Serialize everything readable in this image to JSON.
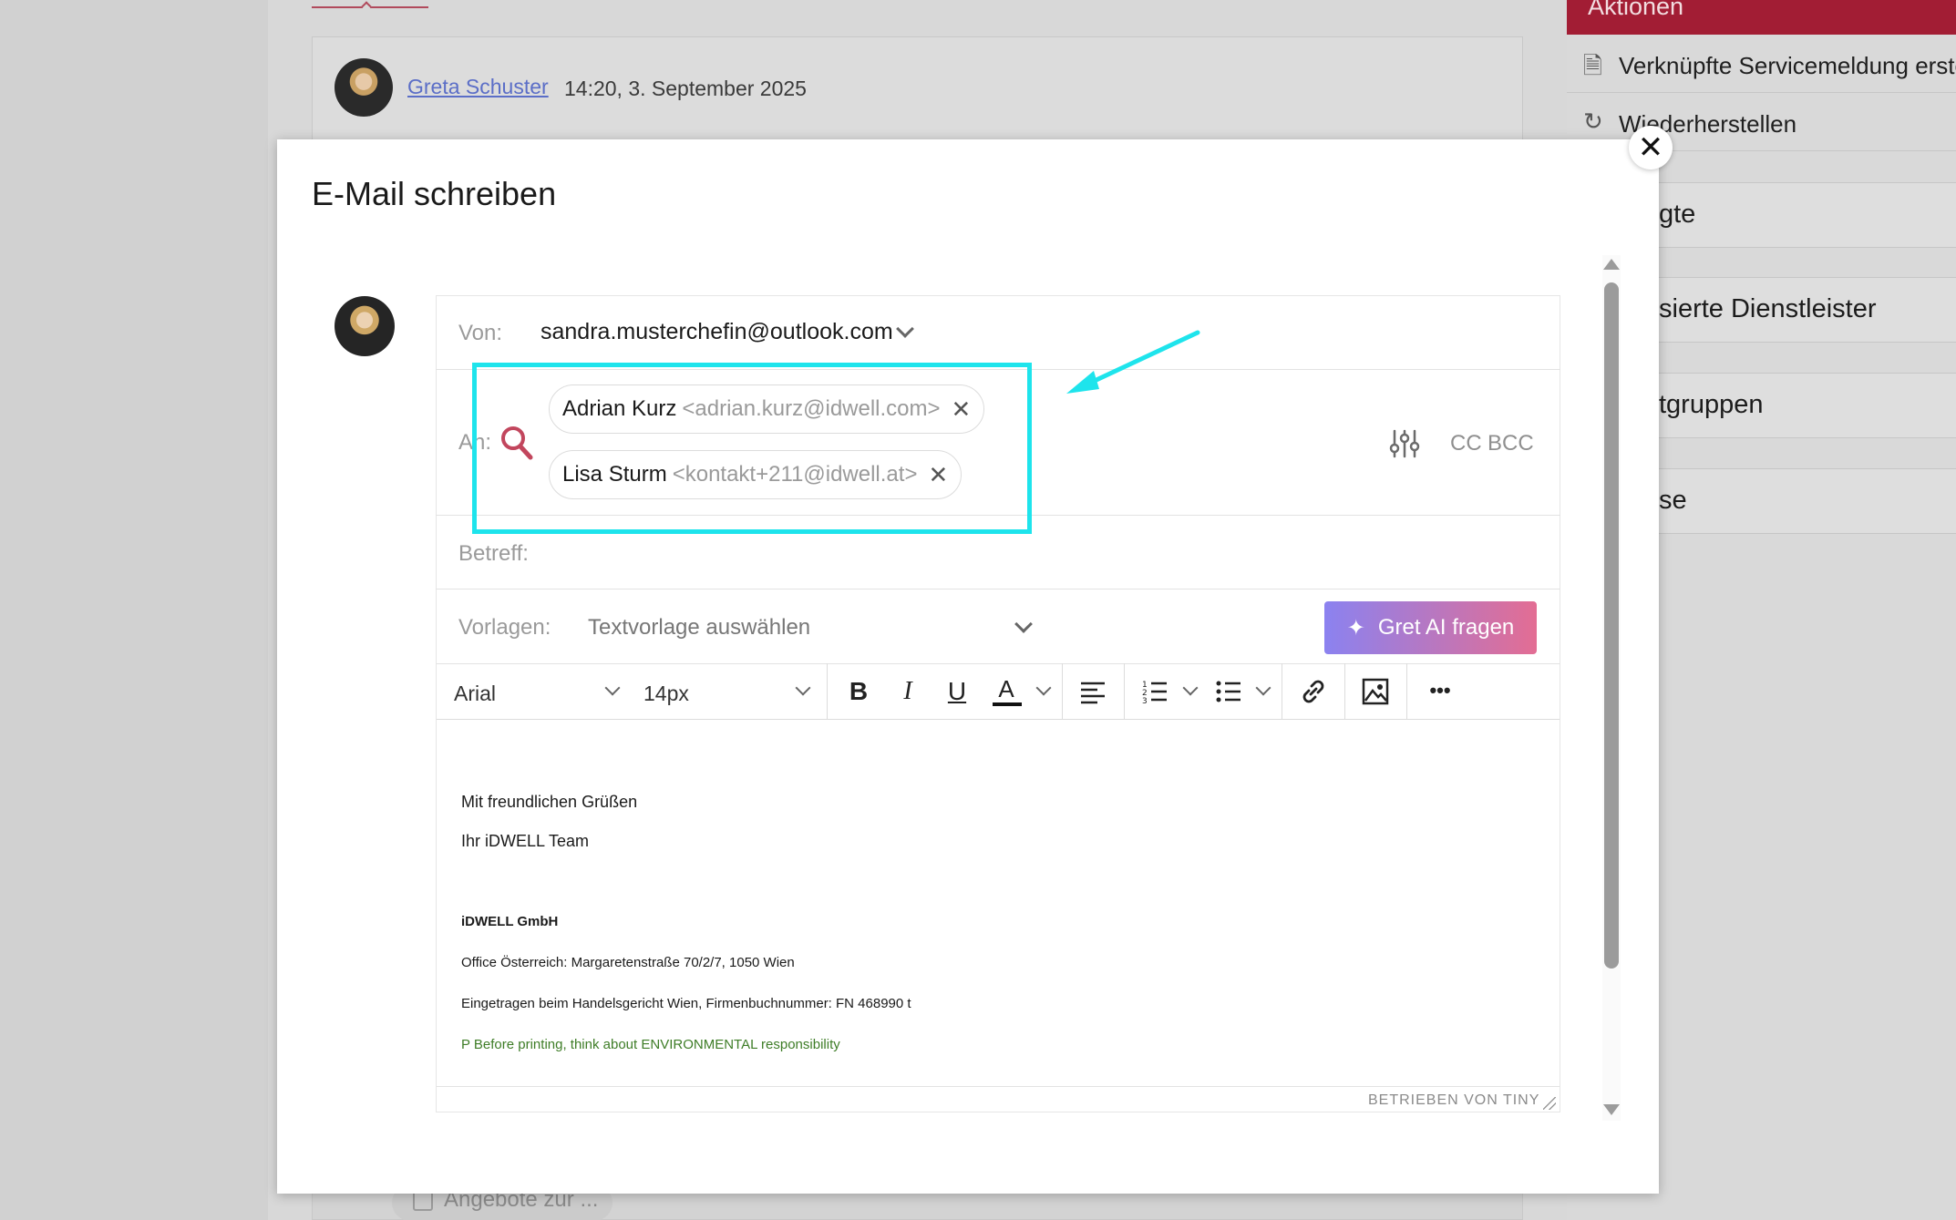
{
  "background": {
    "author": "Greta Schuster",
    "timestamp": "14:20, 3. September 2025",
    "bottom_pill": "Angebote zur ...",
    "actions_title": "Aktionen",
    "actions": [
      {
        "icon": "document-icon",
        "label": "Verknüpfte Servicemeldung erste"
      },
      {
        "icon": "restore-icon",
        "label": "Wiederherstellen"
      }
    ],
    "sections": [
      "gte",
      "sierte Dienstleister",
      "tgruppen",
      "se"
    ]
  },
  "modal": {
    "title": "E-Mail schreiben",
    "close": "✕",
    "from_label": "Von:",
    "from_value": "sandra.musterchefin@outlook.com",
    "to_label": "An:",
    "recipients": [
      {
        "name": "Adrian Kurz",
        "email": "<adrian.kurz@idwell.com>"
      },
      {
        "name": "Lisa Sturm",
        "email": "<kontakt+211@idwell.at>"
      }
    ],
    "cc": "CC",
    "bcc": "BCC",
    "subject_label": "Betreff:",
    "templates_label": "Vorlagen:",
    "templates_placeholder": "Textvorlage auswählen",
    "ai_button": "Gret AI fragen",
    "toolbar": {
      "font": "Arial",
      "size": "14px",
      "bold": "B",
      "italic": "I",
      "underline": "U",
      "text_color": "A",
      "more": "•••"
    },
    "body": {
      "greeting": "Mit freundlichen Grüßen",
      "team": "Ihr iDWELL Team",
      "company": "iDWELL GmbH",
      "office": "Office Österreich: Margaretenstraße 70/2/7, 1050 Wien",
      "registry": "Eingetragen beim Handelsgericht Wien, Firmenbuchnummer: FN 468990 t",
      "env": "P Before printing, think about ENVIRONMENTAL responsibility"
    },
    "powered_by": "BETRIEBEN VON TINY"
  },
  "colors": {
    "highlight": "#1ee4ec",
    "accent": "#a21d34",
    "link": "#5b6ec7",
    "search_icon": "#c2465d",
    "env_text": "#3e7d27"
  }
}
